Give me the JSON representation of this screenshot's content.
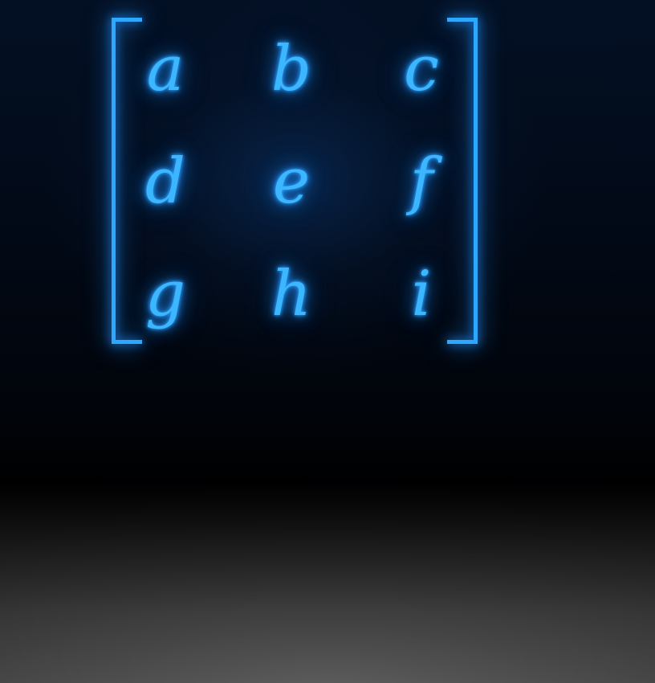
{
  "matrix": {
    "rows": [
      [
        "a",
        "b",
        "c"
      ],
      [
        "d",
        "e",
        "f"
      ],
      [
        "g",
        "h",
        "i"
      ]
    ],
    "glow_color": "#2ea8ff",
    "text_color": "#3cb6ff"
  },
  "scene": {
    "background_top": "#031024",
    "floor_color": "#5c5c5c"
  }
}
